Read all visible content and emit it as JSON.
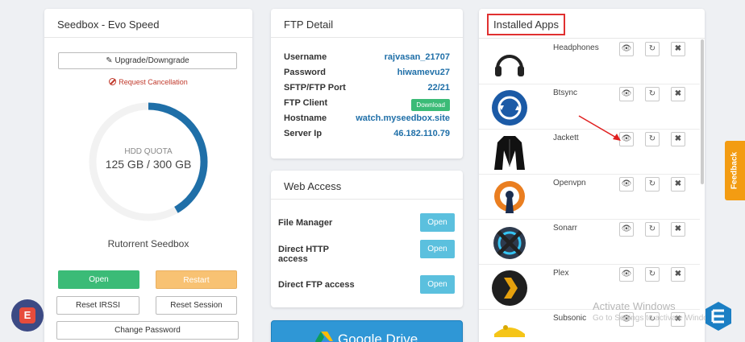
{
  "seedbox": {
    "title": "Seedbox - Evo Speed",
    "upgrade_label": "Upgrade/Downgrade",
    "cancel_label": "Request Cancellation",
    "quota_label": "HDD QUOTA",
    "quota_value": "125 GB / 300 GB",
    "quota_fraction": 0.4167,
    "name": "Rutorrent Seedbox",
    "open_label": "Open",
    "restart_label": "Restart",
    "reset_irssi_label": "Reset IRSSI",
    "reset_session_label": "Reset Session",
    "change_password_label": "Change Password"
  },
  "ftp": {
    "title": "FTP Detail",
    "username_key": "Username",
    "username": "rajvasan_21707",
    "password_key": "Password",
    "password": "hiwamevu27",
    "port_key": "SFTP/FTP Port",
    "port": "22/21",
    "client_key": "FTP Client",
    "download_label": "Download",
    "hostname_key": "Hostname",
    "hostname": "watch.myseedbox.site",
    "ip_key": "Server Ip",
    "ip": "46.182.110.79"
  },
  "web_access": {
    "title": "Web Access",
    "file_manager": "File Manager",
    "direct_http": "Direct HTTP access",
    "direct_ftp": "Direct FTP access",
    "open_label": "Open"
  },
  "gdrive": {
    "label": "Google Drive"
  },
  "apps": {
    "title": "Installed Apps",
    "items": [
      {
        "name": "Headphones",
        "icon": "headphones-icon"
      },
      {
        "name": "Btsync",
        "icon": "btsync-icon"
      },
      {
        "name": "Jackett",
        "icon": "jacket-icon"
      },
      {
        "name": "Openvpn",
        "icon": "openvpn-icon"
      },
      {
        "name": "Sonarr",
        "icon": "sonarr-icon"
      },
      {
        "name": "Plex",
        "icon": "plex-icon"
      },
      {
        "name": "Subsonic",
        "icon": "subsonic-icon"
      }
    ]
  },
  "feedback": {
    "label": "Feedback"
  },
  "chat": {
    "letter": "E"
  },
  "watermark": {
    "line1": "Activate Windows",
    "line2": "Go to Settings to activate Windows."
  },
  "colors": {
    "accent": "#1f6fa8",
    "green": "#3bbb77",
    "orange": "#f8c273",
    "info": "#5bc0de",
    "danger": "#e03030"
  }
}
